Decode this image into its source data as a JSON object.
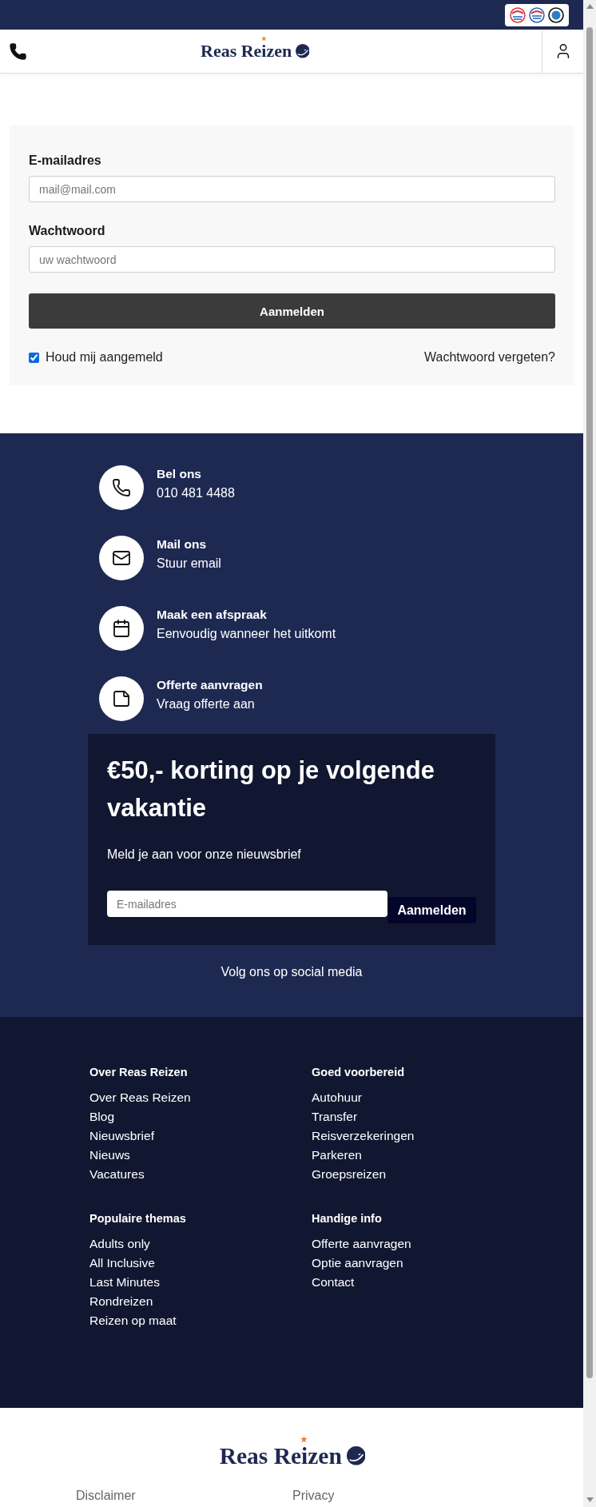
{
  "header": {
    "logo": "Reas Reizen"
  },
  "login": {
    "fields": [
      {
        "label": "E-mailadres",
        "placeholder": "mail@mail.com"
      },
      {
        "label": "Wachtwoord",
        "placeholder": "uw wachtwoord"
      }
    ],
    "submit": "Aanmelden",
    "remember": {
      "label": "Houd mij aangemeld",
      "checked": true
    },
    "forgot": "Wachtwoord vergeten?"
  },
  "contact": [
    {
      "kind": "phone",
      "title": "Bel ons",
      "text": "010 481 4488"
    },
    {
      "kind": "mail",
      "title": "Mail ons",
      "text": "Stuur email"
    },
    {
      "kind": "calendar",
      "title": "Maak een afspraak",
      "text": "Eenvoudig wanneer het uitkomt"
    },
    {
      "kind": "note",
      "title": "Offerte aanvragen",
      "text": "Vraag offerte aan"
    }
  ],
  "newsletter": {
    "title": "€50,- korting op je volgende vakantie",
    "text": "Meld je aan voor onze nieuwsbrief",
    "placeholder": "E-mailadres",
    "button": "Aanmelden"
  },
  "social": "Volg ons op social media",
  "footer": {
    "columns": [
      {
        "title": "Over Reas Reizen",
        "links": [
          "Over Reas Reizen",
          "Blog",
          "Nieuwsbrief",
          "Nieuws",
          "Vacatures"
        ]
      },
      {
        "title": "Goed voorbereid",
        "links": [
          "Autohuur",
          "Transfer",
          "Reisverzekeringen",
          "Parkeren",
          "Groepsreizen"
        ]
      },
      {
        "title": "Populaire themas",
        "links": [
          "Adults only",
          "All Inclusive",
          "Last Minutes",
          "Rondreizen",
          "Reizen op maat"
        ]
      },
      {
        "title": "Handige info",
        "links": [
          "Offerte aanvragen",
          "Optie aanvragen",
          "Contact"
        ]
      }
    ]
  },
  "bottom": {
    "logo": "Reas Reizen",
    "links": [
      "Disclaimer",
      "Privacy"
    ]
  }
}
